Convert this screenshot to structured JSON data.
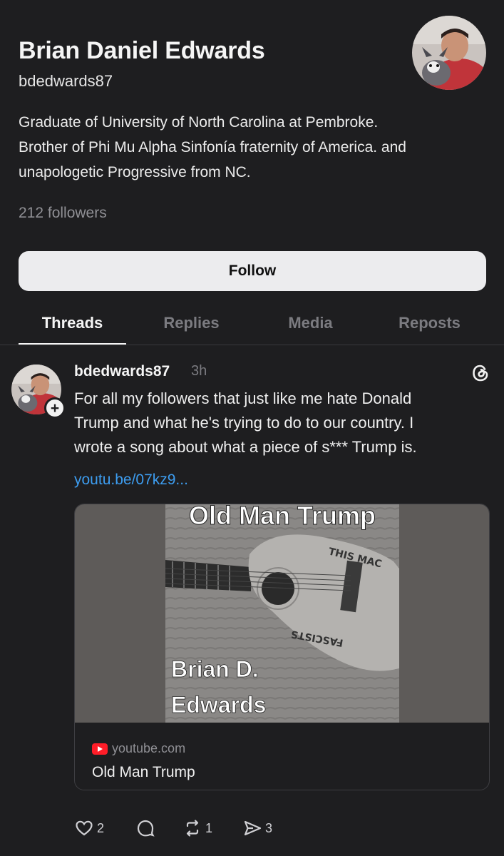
{
  "profile": {
    "name": "Brian Daniel Edwards",
    "handle": "bdedwards87",
    "bio_lines": [
      "Graduate of University of North Carolina at Pembroke.",
      "Brother of Phi Mu Alpha Sinfonía fraternity of America. and",
      "unapologetic Progressive from NC."
    ],
    "followers": "212 followers",
    "follow_label": "Follow"
  },
  "tabs": [
    {
      "label": "Threads",
      "active": true
    },
    {
      "label": "Replies",
      "active": false
    },
    {
      "label": "Media",
      "active": false
    },
    {
      "label": "Reposts",
      "active": false
    }
  ],
  "post": {
    "handle": "bdedwards87",
    "time": "3h",
    "text_lines": [
      "For all my followers that just like me hate Donald",
      "Trump and what he's trying to do to our country. I",
      "wrote a song about what a piece of s*** Trump is."
    ],
    "link": "youtu.be/07kz9...",
    "card": {
      "image_title": "Old Man Trump",
      "image_text_1": "THIS MAC",
      "image_text_2": "FASCISTS",
      "image_artist_1": "Brian D.",
      "image_artist_2": "Edwards",
      "site": "youtube.com",
      "title": "Old Man Trump"
    },
    "actions": {
      "likes": "2",
      "reposts": "1",
      "shares": "3"
    }
  },
  "colors": {
    "background": "#1e1e20",
    "link": "#3d9df0",
    "muted": "#8f8f94",
    "youtube_red": "#ff1d28"
  }
}
